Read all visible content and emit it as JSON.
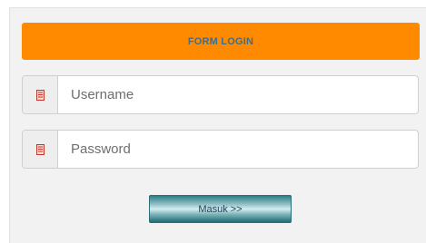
{
  "header": {
    "title": "FORM LOGIN"
  },
  "fields": {
    "username": {
      "placeholder": "Username",
      "icon": "id-card-icon"
    },
    "password": {
      "placeholder": "Password",
      "icon": "id-card-icon"
    }
  },
  "submit": {
    "label": "Masuk >>"
  },
  "colors": {
    "header_bg": "#ff8a00",
    "header_text": "#3e6f8a",
    "icon_accent": "#c0392b",
    "button_accent": "#2e7d86"
  }
}
